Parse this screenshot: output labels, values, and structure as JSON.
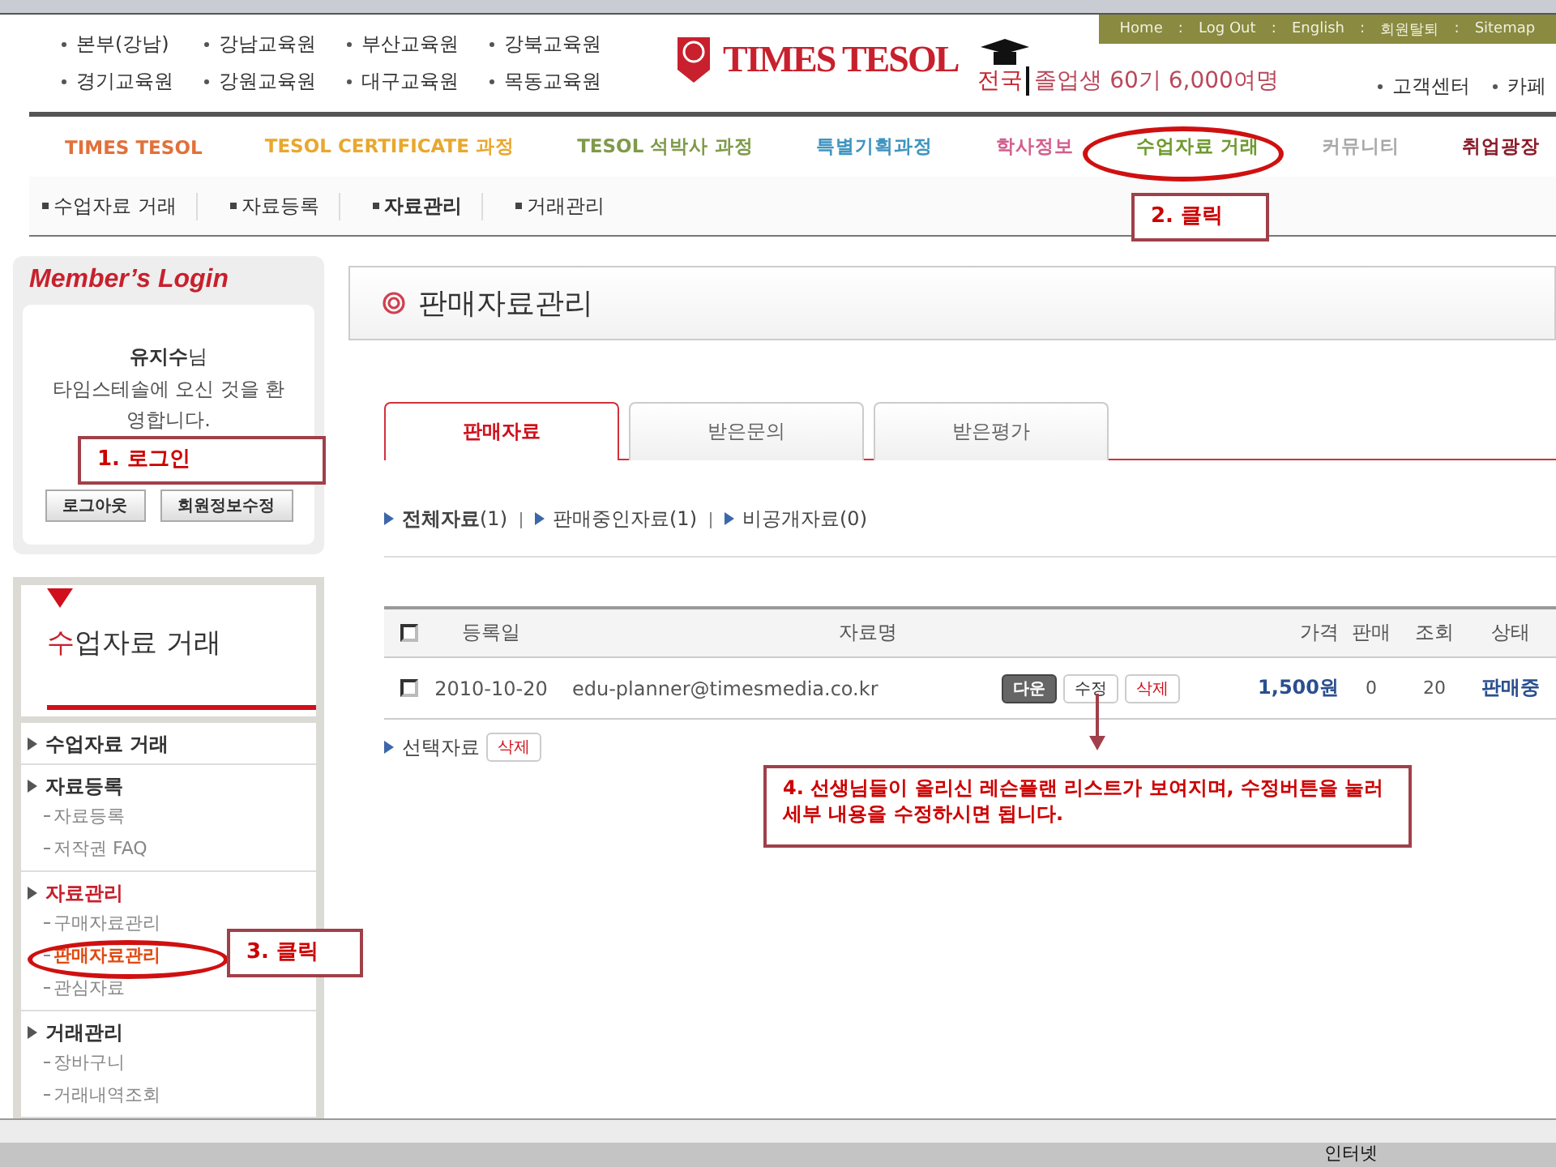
{
  "header": {
    "branches": [
      "본부(강남)",
      "강남교육원",
      "부산교육원",
      "강북교육원",
      "경기교육원",
      "강원교육원",
      "대구교육원",
      "목동교육원"
    ],
    "logo": "TIMES TESOL",
    "slogan_prefix": "전국",
    "slogan": "졸업생 60기 6,000여명",
    "top_links": [
      "Home",
      ":",
      "Log Out",
      ":",
      "English",
      ":",
      "회원탈퇴",
      ":",
      "Sitemap"
    ],
    "util_links": [
      "고객센터",
      "카페"
    ]
  },
  "main_nav": [
    {
      "label": "TIMES TESOL",
      "color": "#e2703a"
    },
    {
      "label": "TESOL CERTIFICATE 과정",
      "color": "#e8a82e"
    },
    {
      "label": "TESOL 석박사 과정",
      "color": "#7f9a4a"
    },
    {
      "label": "특별기획과정",
      "color": "#3f95c0"
    },
    {
      "label": "학사정보",
      "color": "#d2608e"
    },
    {
      "label": "수업자료 거래",
      "color": "#6e9a2f"
    },
    {
      "label": "커뮤니티",
      "color": "#a8a8a8"
    },
    {
      "label": "취업광장",
      "color": "#8a1c2a"
    }
  ],
  "sub_nav": [
    {
      "label": "수업자료 거래",
      "selected": false
    },
    {
      "label": "자료등록",
      "selected": false
    },
    {
      "label": "자료관리",
      "selected": true
    },
    {
      "label": "거래관리",
      "selected": false
    }
  ],
  "login": {
    "title": "Member’s Login",
    "greeting": "**유지수**님",
    "welcome": "타임스테솔에 오신 것을 환영합니다.",
    "buttons": [
      "로그아웃",
      "회원정보수정"
    ]
  },
  "menu": {
    "title": "수업자료 거래",
    "groups": [
      {
        "label": "수업자료 거래",
        "selected": false
      },
      {
        "label": "자료등록",
        "selected": false,
        "children": [
          {
            "label": "자료등록",
            "selected": false
          },
          {
            "label": "저작권 FAQ",
            "selected": false
          }
        ]
      },
      {
        "label": "자료관리",
        "selected": true,
        "children": [
          {
            "label": "구매자료관리",
            "selected": false
          },
          {
            "label": "판매자료관리",
            "selected": true
          },
          {
            "label": "관심자료",
            "selected": false
          }
        ]
      },
      {
        "label": "거래관리",
        "selected": false,
        "children": [
          {
            "label": "장바구니",
            "selected": false
          },
          {
            "label": "거래내역조회",
            "selected": false
          }
        ]
      }
    ]
  },
  "page_title": "판매자료관리",
  "tabs": [
    {
      "label": "판매자료",
      "selected": true
    },
    {
      "label": "받은문의",
      "selected": false
    },
    {
      "label": "받은평가",
      "selected": false
    }
  ],
  "filters": [
    {
      "label": "전체자료",
      "count": "(1)",
      "selected": true
    },
    {
      "label": "판매중인자료",
      "count": "(1)",
      "selected": false
    },
    {
      "label": "비공개자료",
      "count": "(0)",
      "selected": false
    }
  ],
  "table": {
    "select_all": {
      "checked": false
    },
    "columns": [
      "등록일",
      "자료명",
      "가격",
      "판매",
      "조회",
      "상태"
    ],
    "rows": [
      {
        "checked": false,
        "date": "2010-10-20",
        "name": "edu-planner@timesmedia.co.kr",
        "actions": [
          {
            "label": "다운",
            "kind": "dark"
          },
          {
            "label": "수정",
            "kind": "plain"
          },
          {
            "label": "삭제",
            "kind": "red"
          }
        ],
        "price": "1,500원",
        "sales": "0",
        "views": "20",
        "status": "판매중"
      }
    ]
  },
  "select_action": {
    "label": "선택자료",
    "button": "삭제"
  },
  "annotations": [
    "1. 로그인",
    "2. 클릭",
    "3. 클릭",
    "4. 선생님들이 올리신 레슨플랜 리스트가 보여지며, 수정버튼을 눌러 세부 내용을 수정하시면 됩니다."
  ],
  "status_bar": {
    "zone": "인터넷"
  }
}
